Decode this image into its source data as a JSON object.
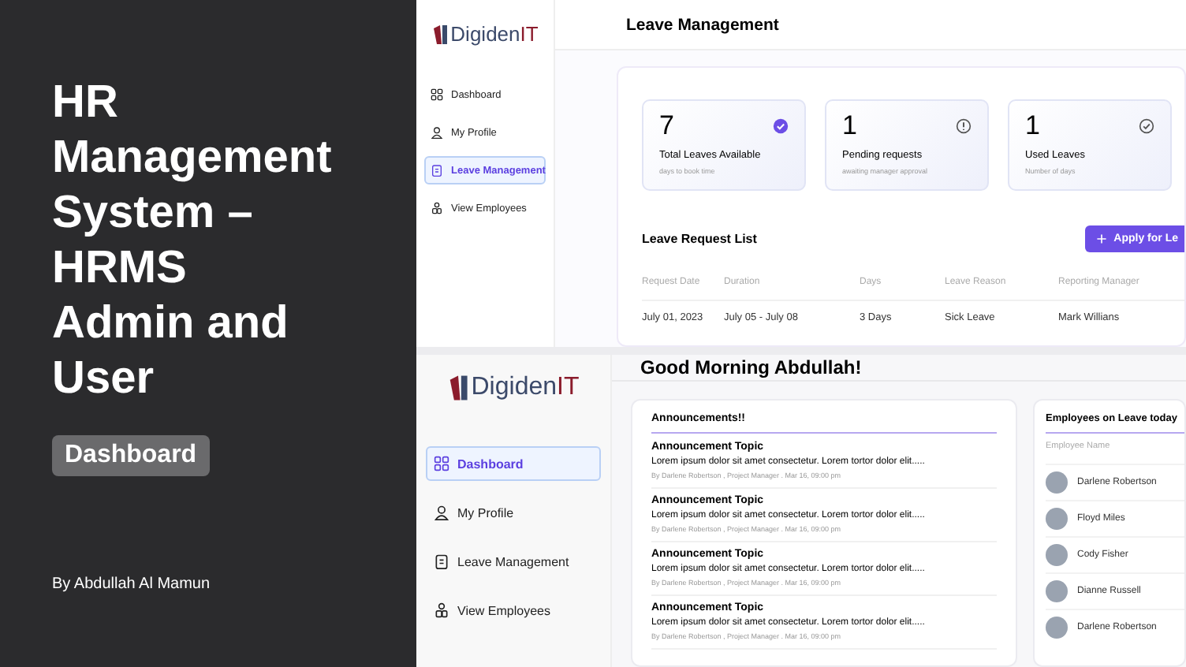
{
  "cover": {
    "title": "HR Management System – HRMS Admin and User",
    "tag": "Dashboard",
    "author": "By Abdullah Al Mamun"
  },
  "leave_screen": {
    "logo": {
      "name": "Digiden",
      "suffix": "IT"
    },
    "nav": [
      {
        "label": "Dashboard",
        "kind": "grid",
        "selected": false
      },
      {
        "label": "My Profile",
        "kind": "person",
        "selected": false
      },
      {
        "label": "Leave Management",
        "kind": "clipboard",
        "selected": true
      },
      {
        "label": "View Employees",
        "kind": "people",
        "selected": false
      }
    ],
    "title": "Leave Management",
    "stats": [
      {
        "value": "7",
        "label": "Total Leaves Available",
        "hint": "days to book time",
        "kind": "done"
      },
      {
        "value": "1",
        "label": "Pending requests",
        "hint": "awaiting manager approval",
        "kind": "pending"
      },
      {
        "value": "1",
        "label": "Used Leaves",
        "hint": "Number of days",
        "kind": "used"
      }
    ],
    "list_title": "Leave Request List",
    "apply_button": "Apply for Le",
    "table": {
      "columns": [
        "Request Date",
        "Duration",
        "Days",
        "Leave Reason",
        "Reporting Manager"
      ],
      "rows": [
        [
          "July 01, 2023",
          "July 05 - July 08",
          "3 Days",
          "Sick Leave",
          "Mark Willians"
        ]
      ]
    }
  },
  "dashboard_screen": {
    "logo": {
      "name": "Digiden",
      "suffix": "IT"
    },
    "nav": [
      {
        "label": "Dashboard",
        "kind": "grid",
        "selected": true
      },
      {
        "label": "My Profile",
        "kind": "person",
        "selected": false
      },
      {
        "label": "Leave Management",
        "kind": "clipboard",
        "selected": false
      },
      {
        "label": "View Employees",
        "kind": "people",
        "selected": false
      }
    ],
    "greeting": "Good Morning Abdullah!",
    "announcements": {
      "title": "Announcements!!",
      "items": [
        {
          "topic": "Announcement Topic",
          "body": "Lorem ipsum dolor sit amet consectetur. Lorem tortor dolor elit.....",
          "meta": "By Darlene Robertson , Project Manager . Mar 16, 09:00 pm"
        },
        {
          "topic": "Announcement Topic",
          "body": "Lorem ipsum dolor sit amet consectetur. Lorem tortor dolor elit.....",
          "meta": "By Darlene Robertson , Project Manager . Mar 16, 09:00 pm"
        },
        {
          "topic": "Announcement Topic",
          "body": "Lorem ipsum dolor sit amet consectetur. Lorem tortor dolor elit.....",
          "meta": "By Darlene Robertson , Project Manager . Mar 16, 09:00 pm"
        },
        {
          "topic": "Announcement Topic",
          "body": "Lorem ipsum dolor sit amet consectetur. Lorem tortor dolor elit.....",
          "meta": "By Darlene Robertson , Project Manager . Mar 16, 09:00 pm"
        }
      ]
    },
    "employees_on_leave": {
      "title": "Employees on Leave today",
      "column": "Employee Name",
      "rows": [
        {
          "name": "Darlene Robertson"
        },
        {
          "name": "Floyd Miles"
        },
        {
          "name": "Cody Fisher"
        },
        {
          "name": "Dianne Russell"
        },
        {
          "name": "Darlene Robertson"
        }
      ]
    }
  }
}
